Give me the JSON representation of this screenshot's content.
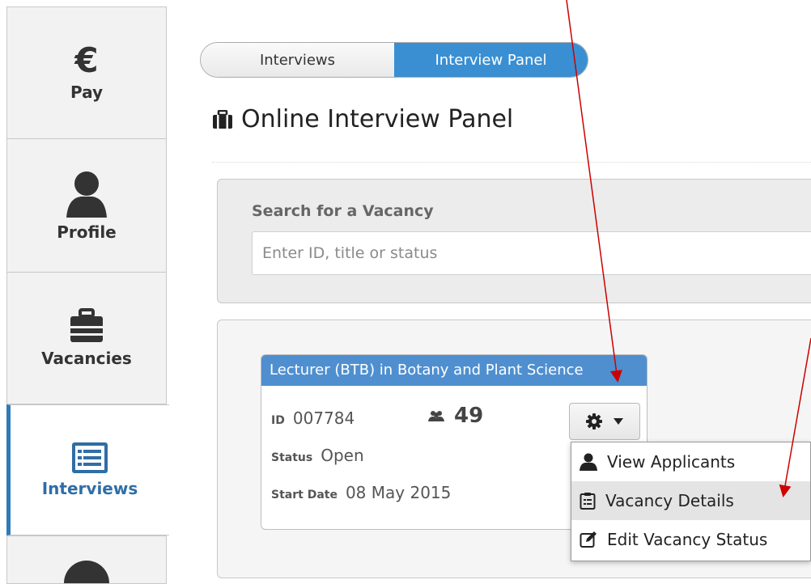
{
  "sidebar": {
    "items": [
      {
        "label": "Pay",
        "icon": "euro-icon",
        "symbol": "€"
      },
      {
        "label": "Profile",
        "icon": "user-icon"
      },
      {
        "label": "Vacancies",
        "icon": "briefcase-icon"
      },
      {
        "label": "Interviews",
        "icon": "list-icon",
        "active": true
      }
    ]
  },
  "tabs": [
    {
      "label": "Interviews",
      "active": false
    },
    {
      "label": "Interview Panel",
      "active": true
    }
  ],
  "page": {
    "title": "Online Interview Panel"
  },
  "search": {
    "label": "Search for a Vacancy",
    "placeholder": "Enter ID, title or status"
  },
  "card": {
    "title": "Lecturer (BTB) in Botany and Plant Science",
    "id_label": "ID",
    "id_value": "007784",
    "count": "49",
    "status_label": "Status",
    "status_value": "Open",
    "start_label": "Start Date",
    "start_value": "08 May 2015"
  },
  "menu": {
    "items": [
      {
        "label": "View Applicants",
        "icon": "user-icon"
      },
      {
        "label": "Vacancy Details",
        "icon": "clipboard-icon",
        "hovered": true
      },
      {
        "label": "Edit Vacancy Status",
        "icon": "edit-icon"
      }
    ]
  },
  "colors": {
    "accent": "#3a8fd2",
    "card_header": "#4f8fcf",
    "annotation_arrow": "#cc0000"
  }
}
